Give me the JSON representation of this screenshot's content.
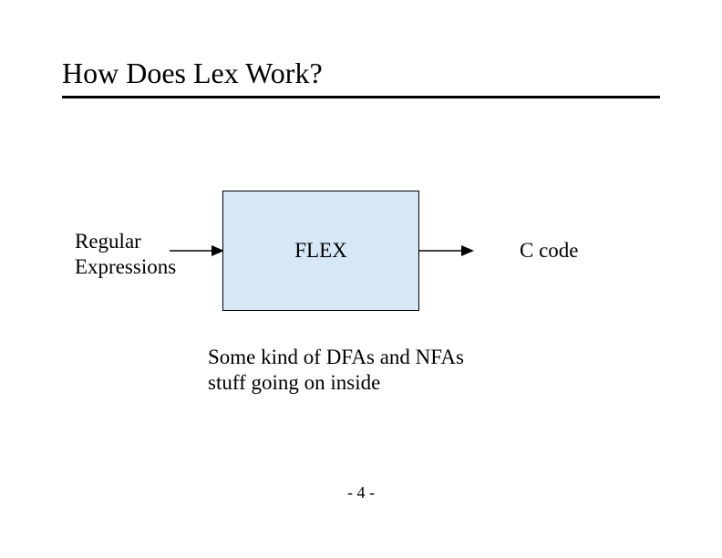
{
  "header": {
    "title": "How Does Lex Work?"
  },
  "diagram": {
    "input_label_line1": "Regular",
    "input_label_line2": "Expressions",
    "box_label": "FLEX",
    "output_label": "C code",
    "caption_line1": "Some kind of DFAs and NFAs",
    "caption_line2": "stuff going on inside"
  },
  "footer": {
    "page_number": "- 4 -"
  },
  "colors": {
    "box_fill": "#d6e7f5",
    "rule": "#000000"
  }
}
